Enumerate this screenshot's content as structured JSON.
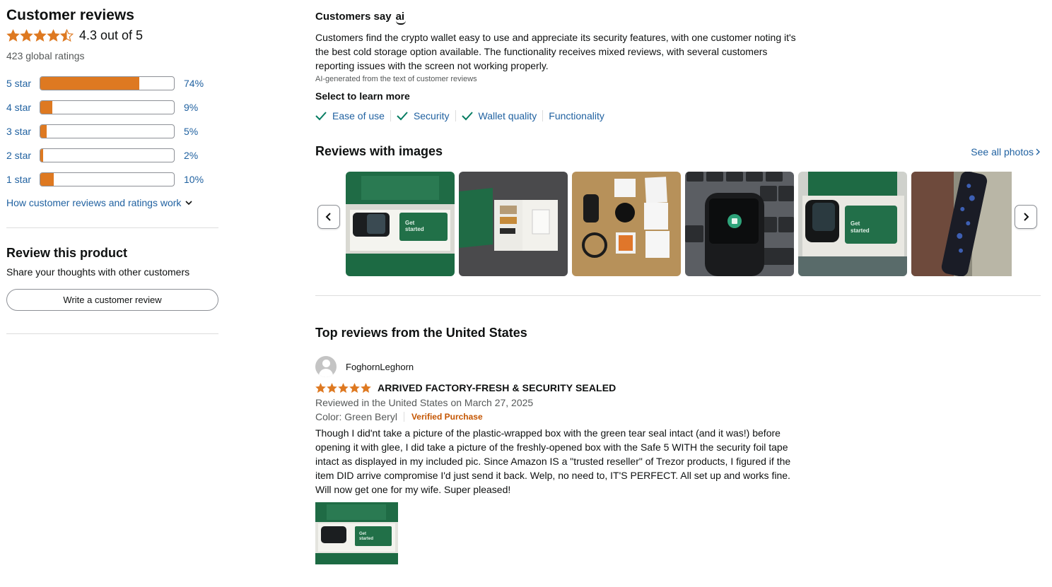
{
  "summary": {
    "title": "Customer reviews",
    "average_text": "4.3 out of 5",
    "average_rating": 4.3,
    "global_ratings": "423 global ratings",
    "histogram": [
      {
        "label": "5 star",
        "percent": "74%",
        "value": 74
      },
      {
        "label": "4 star",
        "percent": "9%",
        "value": 9
      },
      {
        "label": "3 star",
        "percent": "5%",
        "value": 5
      },
      {
        "label": "2 star",
        "percent": "2%",
        "value": 2
      },
      {
        "label": "1 star",
        "percent": "10%",
        "value": 10
      }
    ],
    "how_link": "How customer reviews and ratings work"
  },
  "review_product": {
    "title": "Review this product",
    "subtitle": "Share your thoughts with other customers",
    "button": "Write a customer review"
  },
  "customers_say": {
    "title": "Customers say",
    "ai_badge": "ai",
    "text": "Customers find the crypto wallet easy to use and appreciate its security features, with one customer noting it's the best cold storage option available. The functionality receives mixed reviews, with several customers reporting issues with the screen not working properly.",
    "note": "AI-generated from the text of customer reviews",
    "learn_more": "Select to learn more",
    "aspects": [
      {
        "label": "Ease of use",
        "positive": true
      },
      {
        "label": "Security",
        "positive": true
      },
      {
        "label": "Wallet quality",
        "positive": true
      },
      {
        "label": "Functionality",
        "positive": false
      }
    ]
  },
  "reviews_with_images": {
    "title": "Reviews with images",
    "see_all": "See all photos",
    "thumb_names": [
      "green-box-device-photo",
      "open-box-accessories-photo",
      "stickers-cards-photo",
      "device-on-keyboard-photo",
      "device-in-box-photo",
      "device-closeup-photo"
    ]
  },
  "top_reviews": {
    "title": "Top reviews from the United States",
    "review": {
      "reviewer": "FoghornLeghorn",
      "rating": 5,
      "title": "ARRIVED FACTORY-FRESH & SECURITY SEALED",
      "date": "Reviewed in the United States on March 27, 2025",
      "color": "Color: Green Beryl",
      "verified": "Verified Purchase",
      "body": "Though I did'nt take a picture of the plastic-wrapped box with the green tear seal intact (and it was!) before opening it with glee, I did take a picture of the freshly-opened box with the Safe 5 WITH the security foil tape intact as displayed in my included pic. Since Amazon IS a \"trusted reseller\" of Trezor products, I figured if the item DID arrive compromise I'd just send it back. Welp, no need to, IT'S PERFECT. All set up and works fine. Will now get one for my wife. Super pleased!"
    }
  },
  "colors": {
    "star": "#de7921",
    "link": "#2162a1",
    "verified": "#c45500",
    "check": "#067d62"
  },
  "icons": {
    "prev": "chevron-left-icon",
    "next": "chevron-right-icon",
    "see_all": "chevron-right-icon",
    "check": "checkmark-icon"
  }
}
